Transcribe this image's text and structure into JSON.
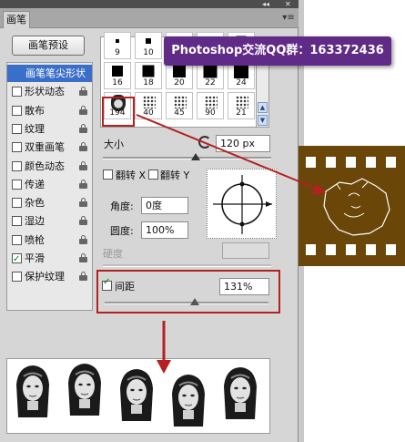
{
  "panel": {
    "title_tab": "画笔",
    "menu_icon": "panel-menu-icon",
    "collapse_icon": "double-arrow-icon",
    "close_icon": "close-icon"
  },
  "preset_button": "画笔预设",
  "options": [
    {
      "label": "画笔笔尖形状",
      "checkbox": false,
      "selected": true,
      "lock": false
    },
    {
      "label": "形状动态",
      "checkbox": true,
      "checked": false,
      "lock": true
    },
    {
      "label": "散布",
      "checkbox": true,
      "checked": false,
      "lock": true
    },
    {
      "label": "纹理",
      "checkbox": true,
      "checked": false,
      "lock": true
    },
    {
      "label": "双重画笔",
      "checkbox": true,
      "checked": false,
      "lock": true
    },
    {
      "label": "颜色动态",
      "checkbox": true,
      "checked": false,
      "lock": true
    },
    {
      "label": "传递",
      "checkbox": true,
      "checked": false,
      "lock": true
    },
    {
      "label": "杂色",
      "checkbox": true,
      "checked": false,
      "lock": true
    },
    {
      "label": "湿边",
      "checkbox": true,
      "checked": false,
      "lock": true
    },
    {
      "label": "喷枪",
      "checkbox": true,
      "checked": false,
      "lock": true
    },
    {
      "label": "平滑",
      "checkbox": true,
      "checked": true,
      "lock": true
    },
    {
      "label": "保护纹理",
      "checkbox": true,
      "checked": false,
      "lock": true
    }
  ],
  "brushes": [
    {
      "num": "9",
      "kind": "square"
    },
    {
      "num": "10",
      "kind": "square"
    },
    {
      "num": "",
      "kind": "square"
    },
    {
      "num": "",
      "kind": "square"
    },
    {
      "num": "",
      "kind": "square"
    },
    {
      "num": "16",
      "kind": "square"
    },
    {
      "num": "18",
      "kind": "square"
    },
    {
      "num": "20",
      "kind": "square"
    },
    {
      "num": "22",
      "kind": "square"
    },
    {
      "num": "24",
      "kind": "square"
    },
    {
      "num": "194",
      "kind": "face"
    },
    {
      "num": "40",
      "kind": "scatter"
    },
    {
      "num": "45",
      "kind": "scatter"
    },
    {
      "num": "90",
      "kind": "scatter"
    },
    {
      "num": "21",
      "kind": "scatter"
    }
  ],
  "size": {
    "label": "大小",
    "value": "120 px",
    "reset_icon": "reset-size-icon",
    "level": 0.55
  },
  "flip_x": {
    "label": "翻转 X"
  },
  "flip_y": {
    "label": "翻转 Y"
  },
  "angle": {
    "label": "角度:",
    "value": "0度"
  },
  "roundness": {
    "label": "圆度:",
    "value": "100%"
  },
  "hardness": {
    "label": "硬度"
  },
  "spacing": {
    "label": "间距",
    "checked": true,
    "value": "131%",
    "level": 0.55
  },
  "banner": "Photoshop交流QQ群：163372436",
  "colors": {
    "film": "#6a4608",
    "accent_red": "#b52020",
    "selected": "#3a6fc9",
    "banner": "#5f2b86"
  }
}
